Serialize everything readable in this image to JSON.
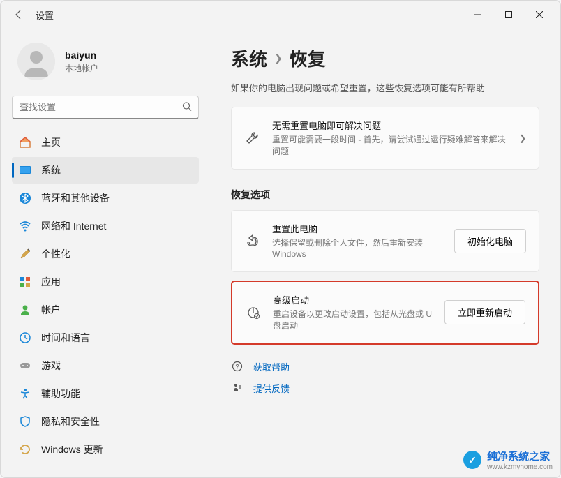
{
  "title": "设置",
  "user": {
    "name": "baiyun",
    "sub": "本地帐户"
  },
  "search": {
    "placeholder": "查找设置"
  },
  "nav": {
    "home": "主页",
    "system": "系统",
    "bluetooth": "蓝牙和其他设备",
    "network": "网络和 Internet",
    "personalization": "个性化",
    "apps": "应用",
    "accounts": "帐户",
    "time": "时间和语言",
    "games": "游戏",
    "accessibility": "辅助功能",
    "privacy": "隐私和安全性",
    "update": "Windows 更新"
  },
  "breadcrumb": {
    "parent": "系统",
    "current": "恢复"
  },
  "page_sub": "如果你的电脑出现问题或希望重置，这些恢复选项可能有所帮助",
  "card1": {
    "title": "无需重置电脑即可解决问题",
    "sub": "重置可能需要一段时间 - 首先，请尝试通过运行疑难解答来解决问题"
  },
  "section": "恢复选项",
  "reset": {
    "title": "重置此电脑",
    "sub": "选择保留或删除个人文件，然后重新安装 Windows",
    "btn": "初始化电脑"
  },
  "advanced": {
    "title": "高级启动",
    "sub": "重启设备以更改启动设置，包括从光盘或 U 盘启动",
    "btn": "立即重新启动"
  },
  "help": "获取帮助",
  "feedback": "提供反馈",
  "watermark": {
    "text": "纯净系统之家",
    "sub": "www.kzmyhome.com"
  }
}
